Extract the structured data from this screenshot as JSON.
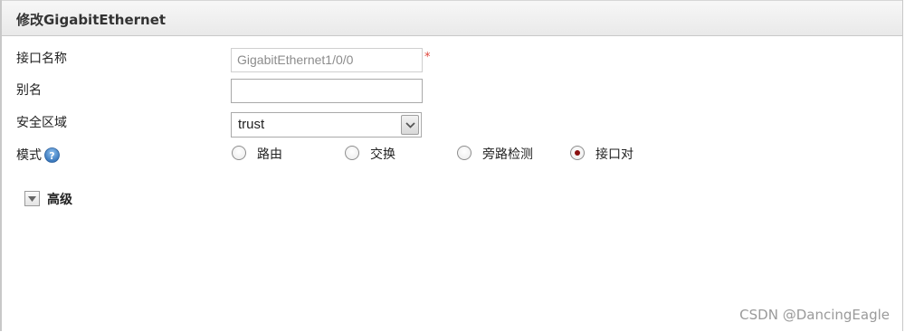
{
  "dialog": {
    "title": "修改GigabitEthernet"
  },
  "form": {
    "interface_name": {
      "label": "接口名称",
      "value": "GigabitEthernet1/0/0",
      "required_mark": "*"
    },
    "alias": {
      "label": "别名",
      "value": ""
    },
    "security_zone": {
      "label": "安全区域",
      "selected": "trust"
    },
    "mode": {
      "label": "模式",
      "help_icon": "question-circle-icon",
      "options": [
        {
          "label": "路由",
          "checked": false
        },
        {
          "label": "交换",
          "checked": false
        },
        {
          "label": "旁路检测",
          "checked": false
        },
        {
          "label": "接口对",
          "checked": true
        }
      ]
    },
    "advanced": {
      "label": "高级",
      "toggle_icon": "caret-down-icon"
    }
  },
  "watermark": "CSDN @DancingEagle",
  "colors": {
    "required": "#e0453a",
    "radio_selected": "#8a0f0f",
    "help_icon": "#3b7dc4"
  }
}
